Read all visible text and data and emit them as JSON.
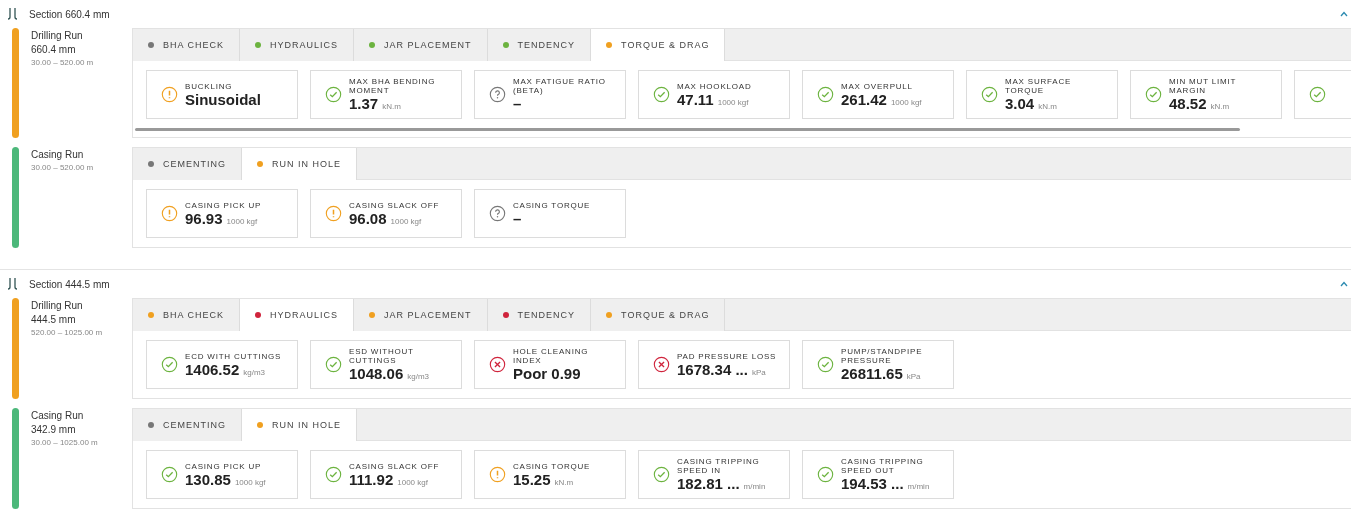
{
  "sections": [
    {
      "title": "Section 660.4 mm",
      "runs": [
        {
          "name": "Drilling Run",
          "size": "660.4 mm",
          "range": "30.00 – 520.00 m",
          "color": "#f0a020",
          "scrollbar": true,
          "tabs": [
            {
              "label": "BHA CHECK",
              "color": "#777777",
              "selected": false
            },
            {
              "label": "HYDRAULICS",
              "color": "#6cb33f",
              "selected": false
            },
            {
              "label": "JAR PLACEMENT",
              "color": "#6cb33f",
              "selected": false
            },
            {
              "label": "TENDENCY",
              "color": "#6cb33f",
              "selected": false
            },
            {
              "label": "TORQUE & DRAG",
              "color": "#f0a020",
              "selected": true
            }
          ],
          "cards": [
            {
              "label": "BUCKLING",
              "value": "Sinusoidal",
              "kind": "warn"
            },
            {
              "label": "MAX BHA BENDING MOMENT",
              "value": "1.37",
              "unit": "kN.m",
              "kind": "ok"
            },
            {
              "label": "MAX FATIGUE RATIO (BETA)",
              "value": "–",
              "kind": "unknown"
            },
            {
              "label": "MAX HOOKLOAD",
              "value": "47.11",
              "unit": "1000 kgf",
              "kind": "ok"
            },
            {
              "label": "MAX OVERPULL",
              "value": "261.42",
              "unit": "1000 kgf",
              "kind": "ok"
            },
            {
              "label": "MAX SURFACE TORQUE",
              "value": "3.04",
              "unit": "kN.m",
              "kind": "ok"
            },
            {
              "label": "MIN MUT LIMIT MARGIN",
              "value": "48.52",
              "unit": "kN.m",
              "kind": "ok"
            },
            {
              "kind": "ok"
            }
          ]
        },
        {
          "name": "Casing Run",
          "range": "30.00 – 520.00 m",
          "color": "#4cb87a",
          "tabs": [
            {
              "label": "CEMENTING",
              "color": "#777777",
              "selected": false
            },
            {
              "label": "RUN IN HOLE",
              "color": "#f0a020",
              "selected": true
            }
          ],
          "cards": [
            {
              "label": "CASING PICK UP",
              "value": "96.93",
              "unit": "1000 kgf",
              "kind": "warn"
            },
            {
              "label": "CASING SLACK OFF",
              "value": "96.08",
              "unit": "1000 kgf",
              "kind": "warn"
            },
            {
              "label": "CASING TORQUE",
              "value": "–",
              "kind": "unknown"
            }
          ]
        }
      ]
    },
    {
      "title": "Section 444.5 mm",
      "runs": [
        {
          "name": "Drilling Run",
          "size": "444.5 mm",
          "range": "520.00 – 1025.00 m",
          "color": "#f0a020",
          "tabs": [
            {
              "label": "BHA CHECK",
              "color": "#f0a020",
              "selected": false
            },
            {
              "label": "HYDRAULICS",
              "color": "#d0243c",
              "selected": true
            },
            {
              "label": "JAR PLACEMENT",
              "color": "#f0a020",
              "selected": false
            },
            {
              "label": "TENDENCY",
              "color": "#d0243c",
              "selected": false
            },
            {
              "label": "TORQUE & DRAG",
              "color": "#f0a020",
              "selected": false
            }
          ],
          "cards": [
            {
              "label": "ECD WITH CUTTINGS",
              "value": "1406.52",
              "unit": "kg/m3",
              "kind": "ok"
            },
            {
              "label": "ESD WITHOUT CUTTINGS",
              "value": "1048.06",
              "unit": "kg/m3",
              "kind": "ok"
            },
            {
              "label": "HOLE CLEANING INDEX",
              "value": "Poor 0.99",
              "kind": "error"
            },
            {
              "label": "PAD PRESSURE LOSS",
              "value": "1678.34 ...",
              "unit": "kPa",
              "kind": "error"
            },
            {
              "label": "PUMP/STANDPIPE PRESSURE",
              "value": "26811.65",
              "unit": "kPa",
              "kind": "ok"
            }
          ]
        },
        {
          "name": "Casing Run",
          "size": "342.9 mm",
          "range": "30.00 – 1025.00 m",
          "color": "#4cb87a",
          "tabs": [
            {
              "label": "CEMENTING",
              "color": "#777777",
              "selected": false
            },
            {
              "label": "RUN IN HOLE",
              "color": "#f0a020",
              "selected": true
            }
          ],
          "cards": [
            {
              "label": "CASING PICK UP",
              "value": "130.85",
              "unit": "1000 kgf",
              "kind": "ok"
            },
            {
              "label": "CASING SLACK OFF",
              "value": "111.92",
              "unit": "1000 kgf",
              "kind": "ok"
            },
            {
              "label": "CASING TORQUE",
              "value": "15.25",
              "unit": "kN.m",
              "kind": "warn"
            },
            {
              "label": "CASING TRIPPING SPEED IN",
              "value": "182.81 ...",
              "unit": "m/min",
              "kind": "ok"
            },
            {
              "label": "CASING TRIPPING SPEED OUT",
              "value": "194.53 ...",
              "unit": "m/min",
              "kind": "ok"
            }
          ]
        }
      ]
    }
  ]
}
